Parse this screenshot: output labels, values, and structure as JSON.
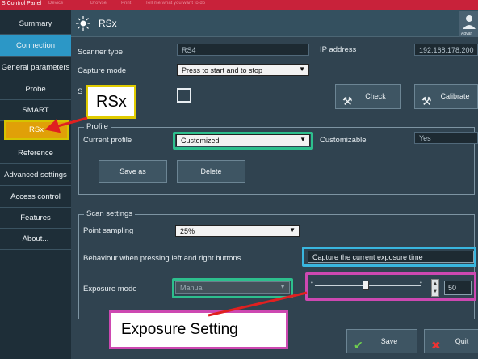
{
  "titlebar": {
    "title": "S Control Panel",
    "ghost_menu": [
      "Device",
      "Browse",
      "Print",
      "Tell me what you want to do"
    ]
  },
  "sidebar": {
    "items": [
      {
        "label": "Summary"
      },
      {
        "label": "Connection"
      },
      {
        "label": "General parameters"
      },
      {
        "label": "Probe"
      },
      {
        "label": "SMART"
      },
      {
        "label": "RSx"
      },
      {
        "label": "Reference"
      },
      {
        "label": "Advanced settings"
      },
      {
        "label": "Access control"
      },
      {
        "label": "Features"
      },
      {
        "label": "About..."
      }
    ],
    "selected": "Connection",
    "highlighted": "RSx"
  },
  "header": {
    "title": "RSx",
    "advanced_label": "Advan"
  },
  "scanner": {
    "scanner_type_label": "Scanner type",
    "scanner_type_value": "RS4",
    "ip_label": "IP address",
    "ip_value": "192.168.178.200",
    "capture_mode_label": "Capture mode",
    "capture_mode_value": "Press to start and to stop",
    "hidden_row_label_start": "S",
    "check_button": "Check",
    "calibrate_button": "Calibrate"
  },
  "profile": {
    "group_label": "Profile",
    "current_profile_label": "Current profile",
    "current_profile_value": "Customized",
    "customizable_label": "Customizable",
    "customizable_value": "Yes",
    "save_as_button": "Save as",
    "delete_button": "Delete"
  },
  "scan_settings": {
    "group_label": "Scan settings",
    "point_sampling_label": "Point sampling",
    "point_sampling_value": "25%",
    "behaviour_label": "Behaviour when pressing left and right buttons",
    "behaviour_value": "Capture the current exposure time",
    "exposure_mode_label": "Exposure mode",
    "exposure_mode_value": "Manual",
    "exposure_value": "50",
    "exposure_level": 0.48
  },
  "footer": {
    "save_button": "Save",
    "quit_button": "Quit"
  },
  "annotations": {
    "rsx_callout": "RSx",
    "exposure_callout": "Exposure Setting"
  },
  "colors": {
    "selected_nav": "#2c97c6",
    "rsx_highlight": "#e0a008",
    "green_box": "#2dbf8d",
    "cyan_box": "#39b6df",
    "pink_box": "#cd48b1",
    "callout_border": "#e0cb00",
    "arrow": "#e02020"
  }
}
